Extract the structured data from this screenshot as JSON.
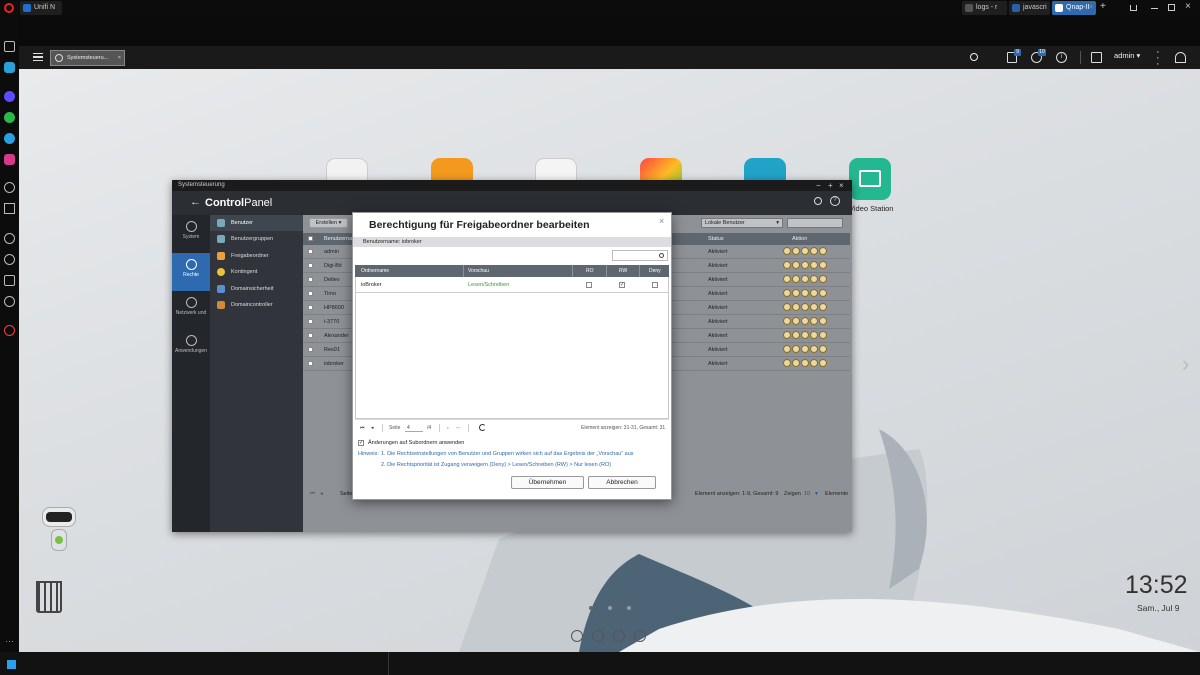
{
  "browser": {
    "tabs": [
      {
        "label": "Unifi N",
        "active": false
      },
      {
        "label": "logs - r",
        "active": false
      },
      {
        "label": "javascri",
        "active": false
      },
      {
        "label": "Qnap-II",
        "active": true
      }
    ],
    "app_tab": "Systemsteueru..."
  },
  "qts": {
    "user": "admin",
    "badges": [
      "9",
      "10"
    ]
  },
  "desktop": {
    "video_station_label": "Video Station",
    "clock_time": "13:52",
    "clock_date": "Sam., Jul 9",
    "page_dots": 3
  },
  "control_panel": {
    "window_title": "Systemsteuerung",
    "header_bold": "Control",
    "header_light": "Panel",
    "nav": [
      {
        "label": "System",
        "active": false
      },
      {
        "label": "Rechte",
        "active": true
      },
      {
        "label": "Netzwerk und",
        "active": false
      },
      {
        "label": "Anwendungen",
        "active": false
      }
    ],
    "sub_nav": [
      {
        "label": "Benutzer",
        "active": true
      },
      {
        "label": "Benutzergruppen",
        "active": false
      },
      {
        "label": "Freigabeordner",
        "active": false
      },
      {
        "label": "Kontingent",
        "active": false
      },
      {
        "label": "Domainsicherheit",
        "active": false
      },
      {
        "label": "Domaincontroller",
        "active": false
      }
    ],
    "create_button": "Erstellen",
    "filter_select": "Lokale Benutzer",
    "columns": [
      "Benutzerna",
      "Status",
      "Aktion"
    ],
    "users": [
      {
        "name": "admin",
        "status": "Aktiviert"
      },
      {
        "name": "Digi-Bit",
        "status": "Aktiviert"
      },
      {
        "name": "Detlev",
        "status": "Aktiviert"
      },
      {
        "name": "Timo",
        "status": "Aktiviert"
      },
      {
        "name": "HP8600",
        "status": "Aktiviert"
      },
      {
        "name": "i-3770",
        "status": "Aktiviert"
      },
      {
        "name": "Alexander",
        "status": "Aktiviert"
      },
      {
        "name": "Res01",
        "status": "Aktiviert"
      },
      {
        "name": "iobroker",
        "status": "Aktiviert"
      }
    ],
    "footer_page": "Seite",
    "footer_elements": "Element anzeigen: 1-9, Gesamt: 9",
    "footer_show": "Zeigen",
    "footer_show_value": "10",
    "footer_unit": "Elemente"
  },
  "dialog": {
    "title": "Berechtigung für Freigabeordner bearbeiten",
    "username_line": "Benutzername: iobroker",
    "columns": [
      "Ordnername",
      "Vorschau",
      "RO",
      "RW",
      "Deny"
    ],
    "rows": [
      {
        "folder": "ioBroker",
        "preview": "Lesen/Schreiben",
        "ro": false,
        "rw": true,
        "deny": false
      }
    ],
    "pager_page_label": "Seite",
    "pager_page_value": "4",
    "pager_total": "/4",
    "pager_info": "Element anzeigen: 31-31, Gesamt: 31",
    "apply_subfolders": "Änderungen auf Subordnern anwenden",
    "hint_label": "Hinweis:",
    "hint_1": "1. Die Rechtseinstellungen von Benutzer und Gruppen wirken sich auf das Ergebnis der „Vorschau“ aus",
    "hint_2": "2. Die Rechtspriorität ist Zugang verweigern (Deny) > Lesen/Schreiben (RW) > Nur lesen (RO)",
    "ok_button": "Übernehmen",
    "cancel_button": "Abbrechen"
  },
  "colors": {
    "accent": "#2d6ab0",
    "preview_green": "#3a9a3a"
  }
}
